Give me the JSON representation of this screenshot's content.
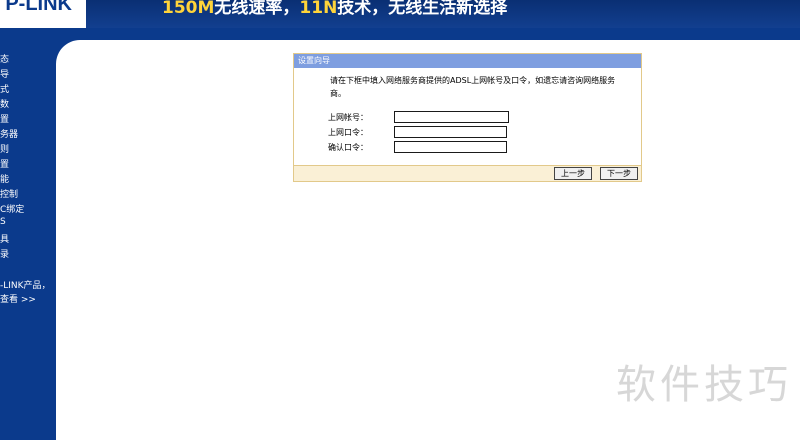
{
  "banner": {
    "logo_text": "P-LINK",
    "slogan_part1": "150M",
    "slogan_part2": "无线速率，",
    "slogan_part3": "11N",
    "slogan_part4": "技术，无线生活新选择"
  },
  "sidebar": {
    "items": [
      {
        "label": "态"
      },
      {
        "label": "导"
      },
      {
        "label": "式"
      },
      {
        "label": "数"
      },
      {
        "label": "置"
      },
      {
        "label": "务器"
      },
      {
        "label": "则"
      },
      {
        "label": "置"
      },
      {
        "label": "能"
      },
      {
        "label": "控制"
      },
      {
        "label": "C绑定"
      },
      {
        "label": "S"
      },
      {
        "label": "具"
      },
      {
        "label": "录"
      }
    ],
    "promo_line1": "-LINK产品，",
    "promo_line2": "查看 >>"
  },
  "wizard": {
    "title": "设置向导",
    "description": "请在下框中填入网络服务商提供的ADSL上网帐号及口令，如遗忘请咨询网络服务商。",
    "fields": [
      {
        "label": "上网帐号：",
        "value": "",
        "placeholder": ""
      },
      {
        "label": "上网口令：",
        "value": "",
        "placeholder": ""
      },
      {
        "label": "确认口令：",
        "value": "",
        "placeholder": ""
      }
    ],
    "prev_label": "上一步",
    "next_label": "下一步"
  },
  "watermark": "软件技巧"
}
